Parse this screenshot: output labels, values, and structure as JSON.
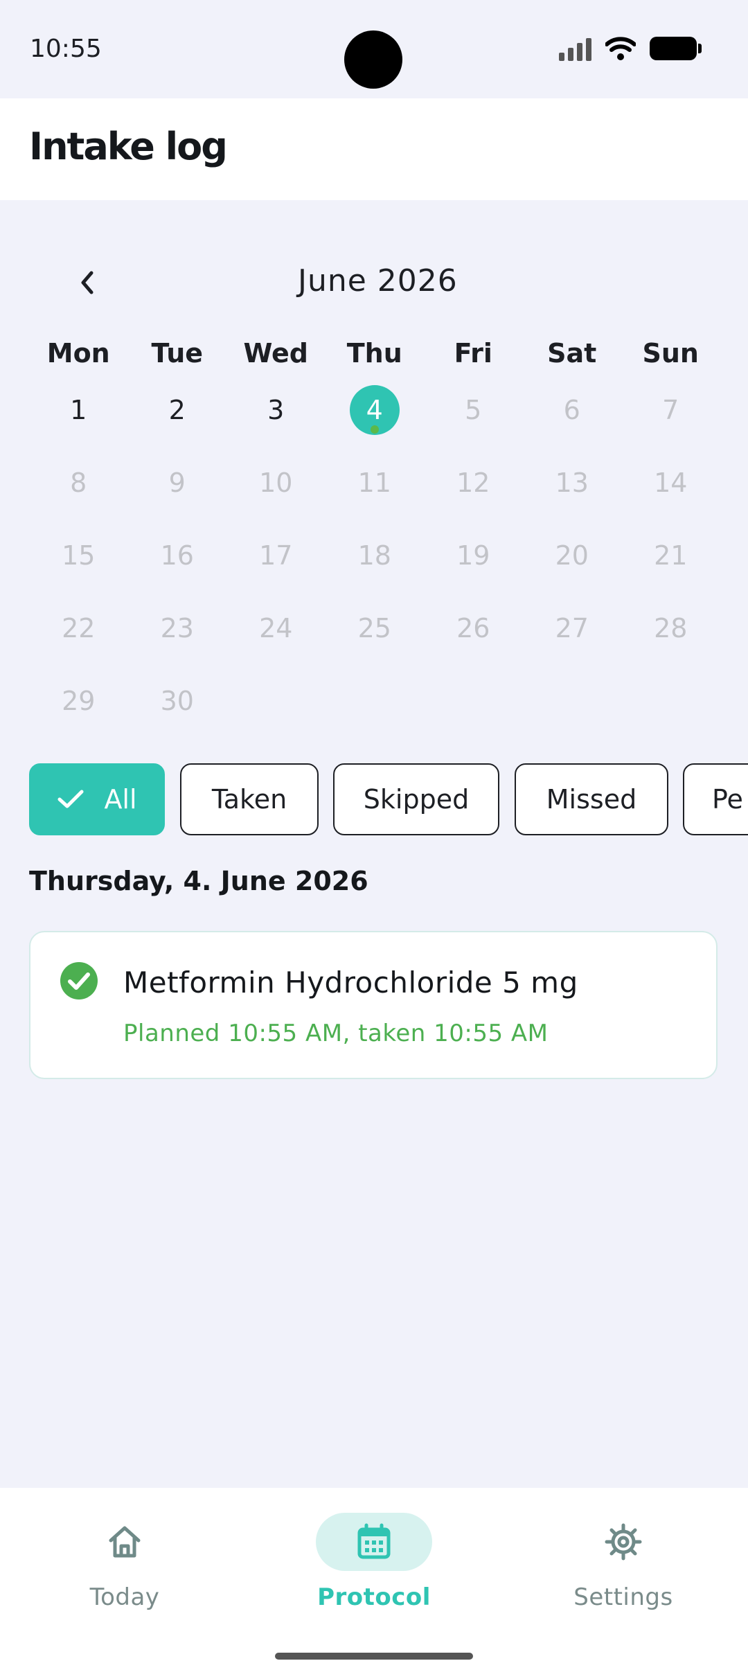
{
  "status_bar": {
    "time": "10:55"
  },
  "app_bar": {
    "title": "Intake log"
  },
  "calendar": {
    "month_title": "June 2026",
    "weekdays": [
      "Mon",
      "Tue",
      "Wed",
      "Thu",
      "Fri",
      "Sat",
      "Sun"
    ],
    "weeks": [
      [
        "1",
        "2",
        "3",
        "4",
        "5",
        "6",
        "7"
      ],
      [
        "8",
        "9",
        "10",
        "11",
        "12",
        "13",
        "14"
      ],
      [
        "15",
        "16",
        "17",
        "18",
        "19",
        "20",
        "21"
      ],
      [
        "22",
        "23",
        "24",
        "25",
        "26",
        "27",
        "28"
      ],
      [
        "29",
        "30",
        "",
        "",
        "",
        "",
        ""
      ]
    ],
    "selected_day": "4"
  },
  "filters": {
    "all": "All",
    "taken": "Taken",
    "skipped": "Skipped",
    "missed": "Missed",
    "pending": "Pe"
  },
  "log": {
    "date_heading": "Thursday, 4. June 2026",
    "entries": [
      {
        "name": "Metformin Hydrochloride 5 mg",
        "detail": "Planned 10:55 AM, taken 10:55 AM",
        "status_icon": "check-circle-icon"
      }
    ]
  },
  "bottom_nav": {
    "today": "Today",
    "protocol": "Protocol",
    "settings": "Settings"
  },
  "colors": {
    "accent": "#2fc4b2",
    "taken": "#4caf50",
    "background": "#f1f2fa"
  }
}
